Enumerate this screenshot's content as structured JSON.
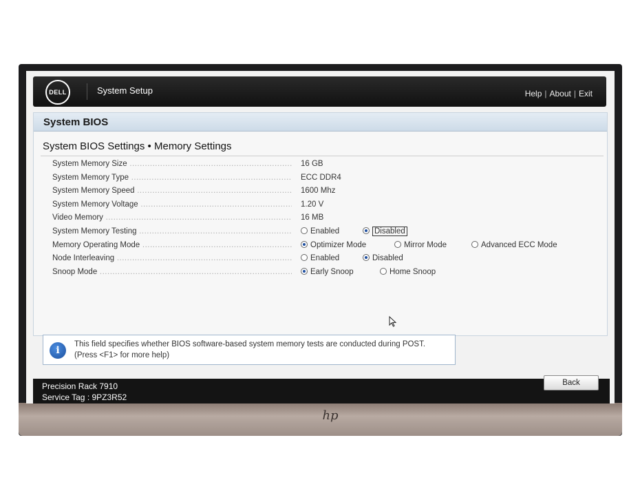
{
  "header": {
    "logo_text": "DELL",
    "title": "System Setup",
    "links": {
      "help": "Help",
      "about": "About",
      "exit": "Exit"
    }
  },
  "section_title": "System BIOS",
  "page_title": "System BIOS Settings • Memory Settings",
  "rows": [
    {
      "label": "System Memory Size",
      "value": "16 GB"
    },
    {
      "label": "System Memory Type",
      "value": "ECC DDR4"
    },
    {
      "label": "System Memory Speed",
      "value": "1600 Mhz"
    },
    {
      "label": "System Memory Voltage",
      "value": "1.20 V"
    },
    {
      "label": "Video Memory",
      "value": "16 MB"
    },
    {
      "label": "System Memory Testing",
      "options": [
        "Enabled",
        "Disabled"
      ],
      "selected": "Disabled"
    },
    {
      "label": "Memory Operating Mode",
      "options": [
        "Optimizer Mode",
        "Mirror Mode",
        "Advanced ECC Mode"
      ],
      "selected": "Optimizer Mode"
    },
    {
      "label": "Node Interleaving",
      "options": [
        "Enabled",
        "Disabled"
      ],
      "selected": "Disabled"
    },
    {
      "label": "Snoop Mode",
      "options": [
        "Early Snoop",
        "Home Snoop"
      ],
      "selected": "Early Snoop"
    }
  ],
  "help_text": "This field specifies whether BIOS software-based system memory tests are conducted during POST. (Press <F1> for more help)",
  "footer": {
    "model": "Precision Rack 7910",
    "service_tag": "Service Tag : 9PZ3R52",
    "back_label": "Back"
  },
  "colors": {
    "accent": "#1f4fa0",
    "header_bg": "#1a1a1a",
    "section_bar": "#d6e2ee"
  }
}
